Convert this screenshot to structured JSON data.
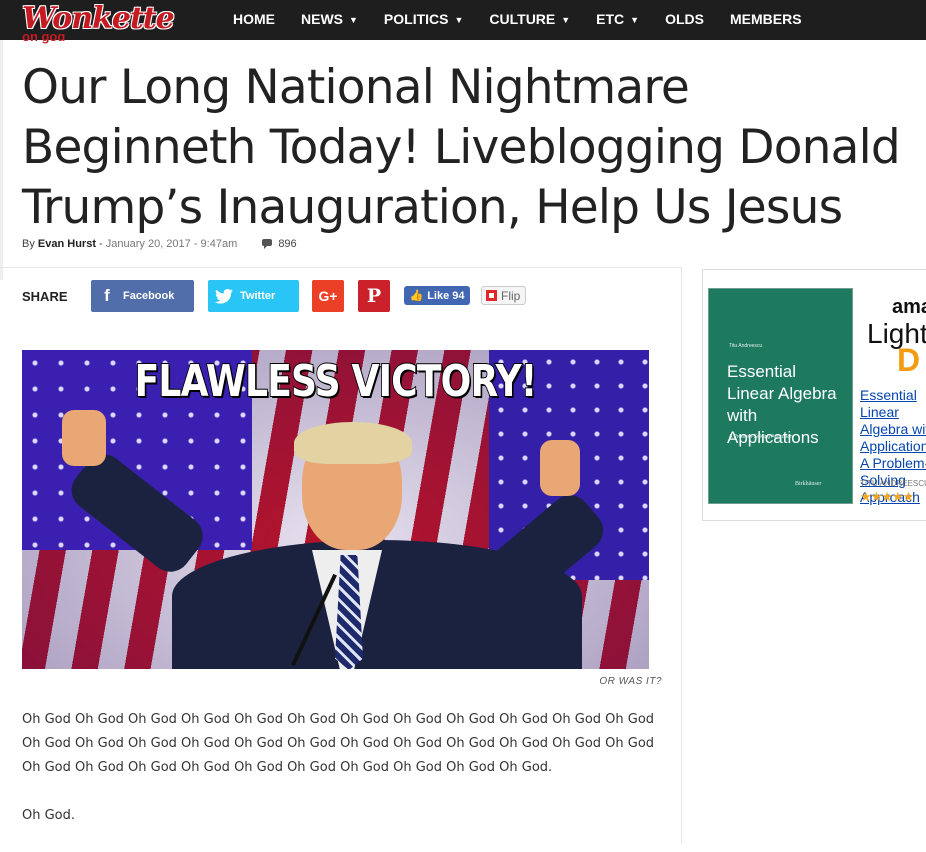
{
  "nav": {
    "logo": "Wonkette",
    "items": [
      {
        "label": "HOME",
        "dropdown": false
      },
      {
        "label": "NEWS",
        "dropdown": true
      },
      {
        "label": "POLITICS",
        "dropdown": true
      },
      {
        "label": "CULTURE",
        "dropdown": true
      },
      {
        "label": "ETC",
        "dropdown": true
      },
      {
        "label": "OLDS",
        "dropdown": false
      },
      {
        "label": "MEMBERS",
        "dropdown": false
      }
    ]
  },
  "article": {
    "tag": "oh god",
    "title": "Our Long National Nightmare Beginneth Today! Liveblogging Donald Trump’s Inauguration, Help Us Jesus",
    "by_prefix": "By",
    "author": "Evan Hurst",
    "date": "January 20, 2017 - 9:47am",
    "comment_count": "896",
    "image_caption_text": "FLAWLESS VICTORY!",
    "image_credit": "OR WAS IT?",
    "paragraphs": [
      "Oh God Oh God Oh God Oh God Oh God Oh God Oh God Oh God Oh God Oh God Oh God Oh God Oh God Oh God Oh God Oh God Oh God Oh God Oh God Oh God Oh God Oh God Oh God Oh God Oh God Oh God Oh God Oh God Oh God Oh God Oh God Oh God Oh God Oh God.",
      "Oh God."
    ]
  },
  "share": {
    "label": "SHARE",
    "facebook": "Facebook",
    "twitter": "Twitter",
    "gplus": "G+",
    "pinterest": "P",
    "like": "Like 94",
    "flip": "Flip"
  },
  "ad": {
    "book_author": "Titu Andreescu",
    "book_title": "Essential Linear Algebra with Applications",
    "book_subtitle": "A Problem-Solving Approach",
    "book_publisher": "Birkhäuser",
    "brand": "ama",
    "headline": "Lightn",
    "headline2": "D",
    "link_text": "Essential Linear Algebra with Applications: A Problem-Solving Approach",
    "author_line": "TITU ANDREESCU",
    "stars": "★★★★★"
  },
  "colors": {
    "brand_red": "#c61a23",
    "nav_bg": "#1e1e1e",
    "facebook": "#516eab",
    "twitter": "#29c5f6",
    "gplus": "#eb4026",
    "pinterest": "#ca212a"
  }
}
